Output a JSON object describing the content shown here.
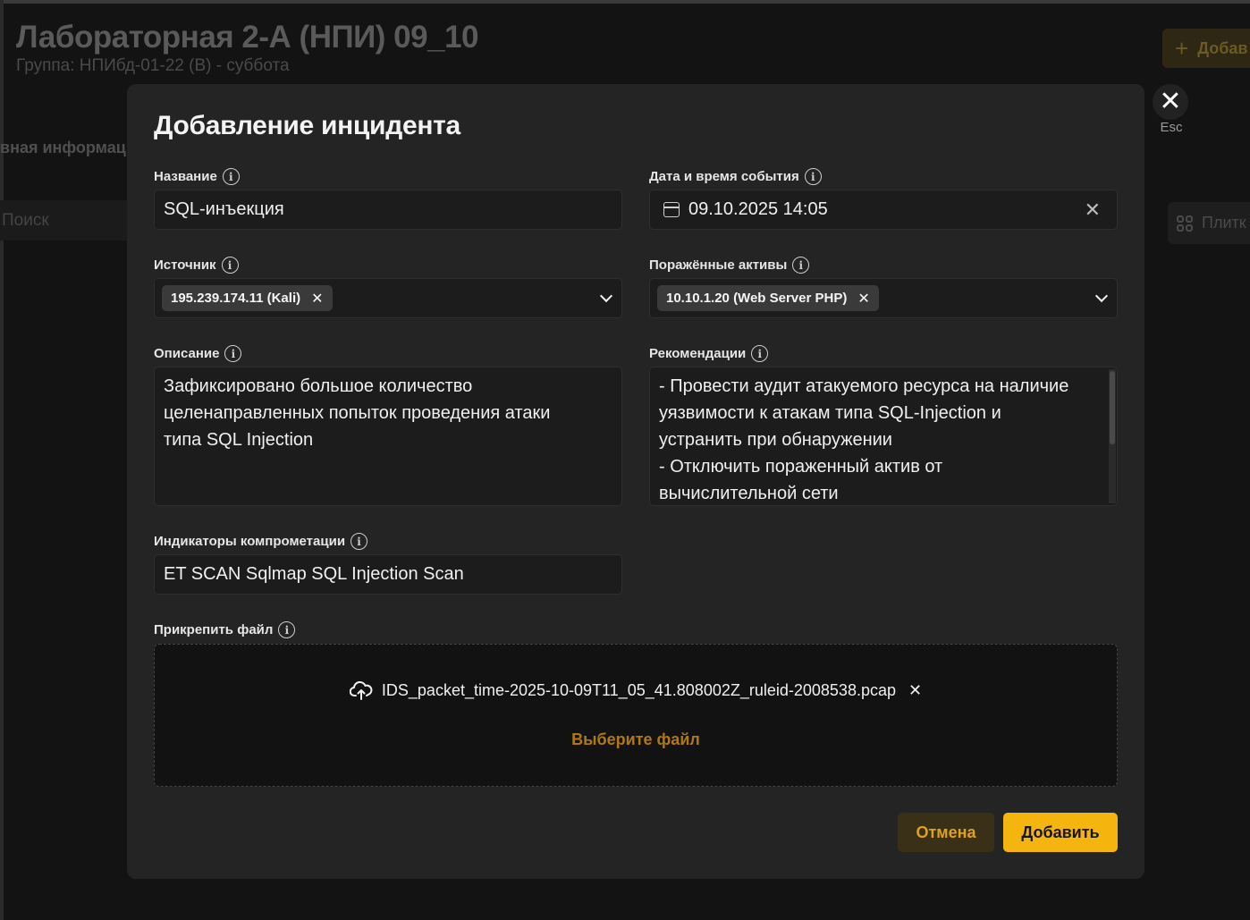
{
  "background": {
    "title": "Лабораторная 2-А (НПИ) 09_10",
    "subtitle": "Группа: НПИбд-01-22 (В) - суббота",
    "add_label": "Добав",
    "info_label": "вная информац",
    "search_placeholder": "Поиск",
    "tiles_label": "Плитк"
  },
  "close": {
    "esc_label": "Esc"
  },
  "modal": {
    "title": "Добавление инцидента",
    "name": {
      "label": "Название",
      "value": "SQL-инъекция"
    },
    "datetime": {
      "label": "Дата и время события",
      "value": "09.10.2025 14:05"
    },
    "source": {
      "label": "Источник",
      "chip": "195.239.174.11 (Kali)"
    },
    "assets": {
      "label": "Поражённые активы",
      "chip": "10.10.1.20 (Web Server PHP)"
    },
    "description": {
      "label": "Описание",
      "lines": [
        "Зафиксировано большое количество",
        "целенаправленных попыток проведения атаки",
        "типа SQL Injection"
      ]
    },
    "recommendations": {
      "label": "Рекомендации",
      "lines": [
        "- Провести аудит атакуемого ресурса на наличие",
        "уязвимости к атакам типа SQL-Injection и",
        "устранить при обнаружении",
        "- Отключить пораженный актив от",
        "вычислительной сети"
      ]
    },
    "ioc": {
      "label": "Индикаторы компрометации",
      "value": "ET SCAN Sqlmap SQL Injection Scan"
    },
    "attach": {
      "label": "Прикрепить файл",
      "file_name": "IDS_packet_time-2025-10-09T11_05_41.808002Z_ruleid-2008538.pcap",
      "choose_label": "Выберите файл"
    },
    "cancel_label": "Отмена",
    "submit_label": "Добавить"
  },
  "colors": {
    "accent": "#f5b50f",
    "accent_text": "#b0790f",
    "modal_bg": "#242424",
    "page_bg": "#131313"
  }
}
